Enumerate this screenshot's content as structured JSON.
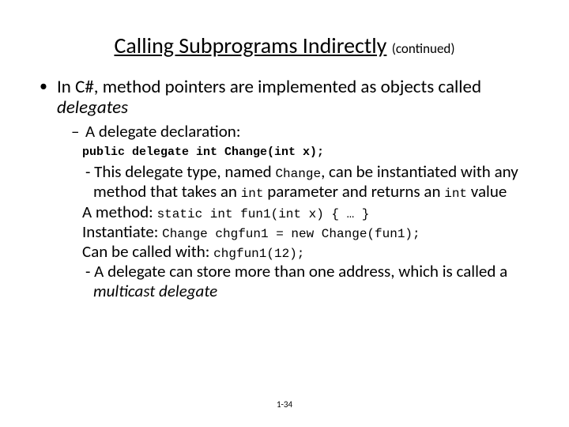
{
  "title_main": "Calling Subprograms Indirectly",
  "title_sub": "(continued)",
  "bullet1_a": "In C#, method pointers are implemented as objects called ",
  "bullet1_b": "delegates",
  "sub1": "A delegate declaration:",
  "code_decl": "public delegate int Change(int x);",
  "p1_a": "- This delegate type, named ",
  "p1_code1": "Change",
  "p1_b": ", can be instantiated with any method that takes an ",
  "p1_code2": "int",
  "p1_c": " parameter and returns an ",
  "p1_code3": "int",
  "p1_d": " value",
  "p2_a": "A method: ",
  "p2_code": "static int fun1(int x) { … }",
  "p3_a": "Instantiate: ",
  "p3_code": "Change chgfun1 = new Change(fun1);",
  "p4_a": "Can be called with: ",
  "p4_code": "chgfun1(12);",
  "p5_a": "- A delegate can store more than one address, which is called a ",
  "p5_b": "multicast delegate",
  "pagenum": "1-34"
}
